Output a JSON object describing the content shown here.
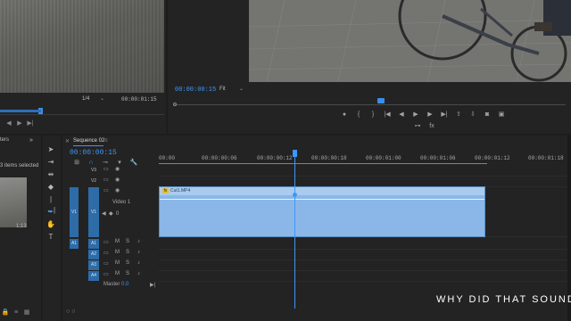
{
  "source_monitor": {
    "scale": "1/4",
    "timecode": "00:00:01:15",
    "controls": [
      "marker-icon",
      "mark-in-icon",
      "mark-out-icon",
      "go-to-in-icon",
      "step-back-icon",
      "play-icon",
      "step-forward-icon",
      "insert-icon",
      "overwrite-icon",
      "export-frame-icon",
      "button-editor-icon"
    ]
  },
  "program_monitor": {
    "timecode": "00:00:00:15",
    "zoom": "Fit",
    "controls": [
      "marker-icon",
      "mark-in-icon",
      "mark-out-icon",
      "go-to-in-icon",
      "step-back-icon",
      "play-icon",
      "step-forward-icon",
      "go-to-out-icon",
      "lift-icon",
      "extract-icon",
      "export-frame-icon",
      "compare-icon"
    ],
    "controls_row2": [
      "vr-icon",
      "fx-icon"
    ]
  },
  "project_panel": {
    "tab_label": "ters",
    "selection_text": "3 items selected",
    "clip_duration": "1;13"
  },
  "timeline": {
    "sequence_name": "Sequence 02",
    "timecode": "00:00:00:15",
    "ruler_ticks": [
      "00:00",
      "00:00:00:06",
      "00:00:00:12",
      "00:00:00:18",
      "00:00:01:00",
      "00:00:01:06",
      "00:00:01:12",
      "00:00:01:18"
    ],
    "video_tracks": [
      {
        "target": "V3",
        "source": ""
      },
      {
        "target": "V2",
        "source": ""
      },
      {
        "target": "V1",
        "source": "V1",
        "name": "Video 1"
      }
    ],
    "audio_tracks": [
      {
        "target": "A1",
        "source": "A1"
      },
      {
        "target": "A2",
        "source": ""
      },
      {
        "target": "A3",
        "source": ""
      },
      {
        "target": "A4",
        "source": ""
      }
    ],
    "track_btn_m": "M",
    "track_btn_s": "S",
    "clip_label": "Cut1.MP4",
    "clip_fx_badge": "fx",
    "v1_keyframe_value": "0",
    "master_label": "Master",
    "master_value": "0.0",
    "subtitle": "WHY DID THAT SOUND D"
  },
  "colors": {
    "accent": "#3f97f5",
    "clip_fill": "#8ab7e8",
    "panel_bg": "#232323"
  }
}
